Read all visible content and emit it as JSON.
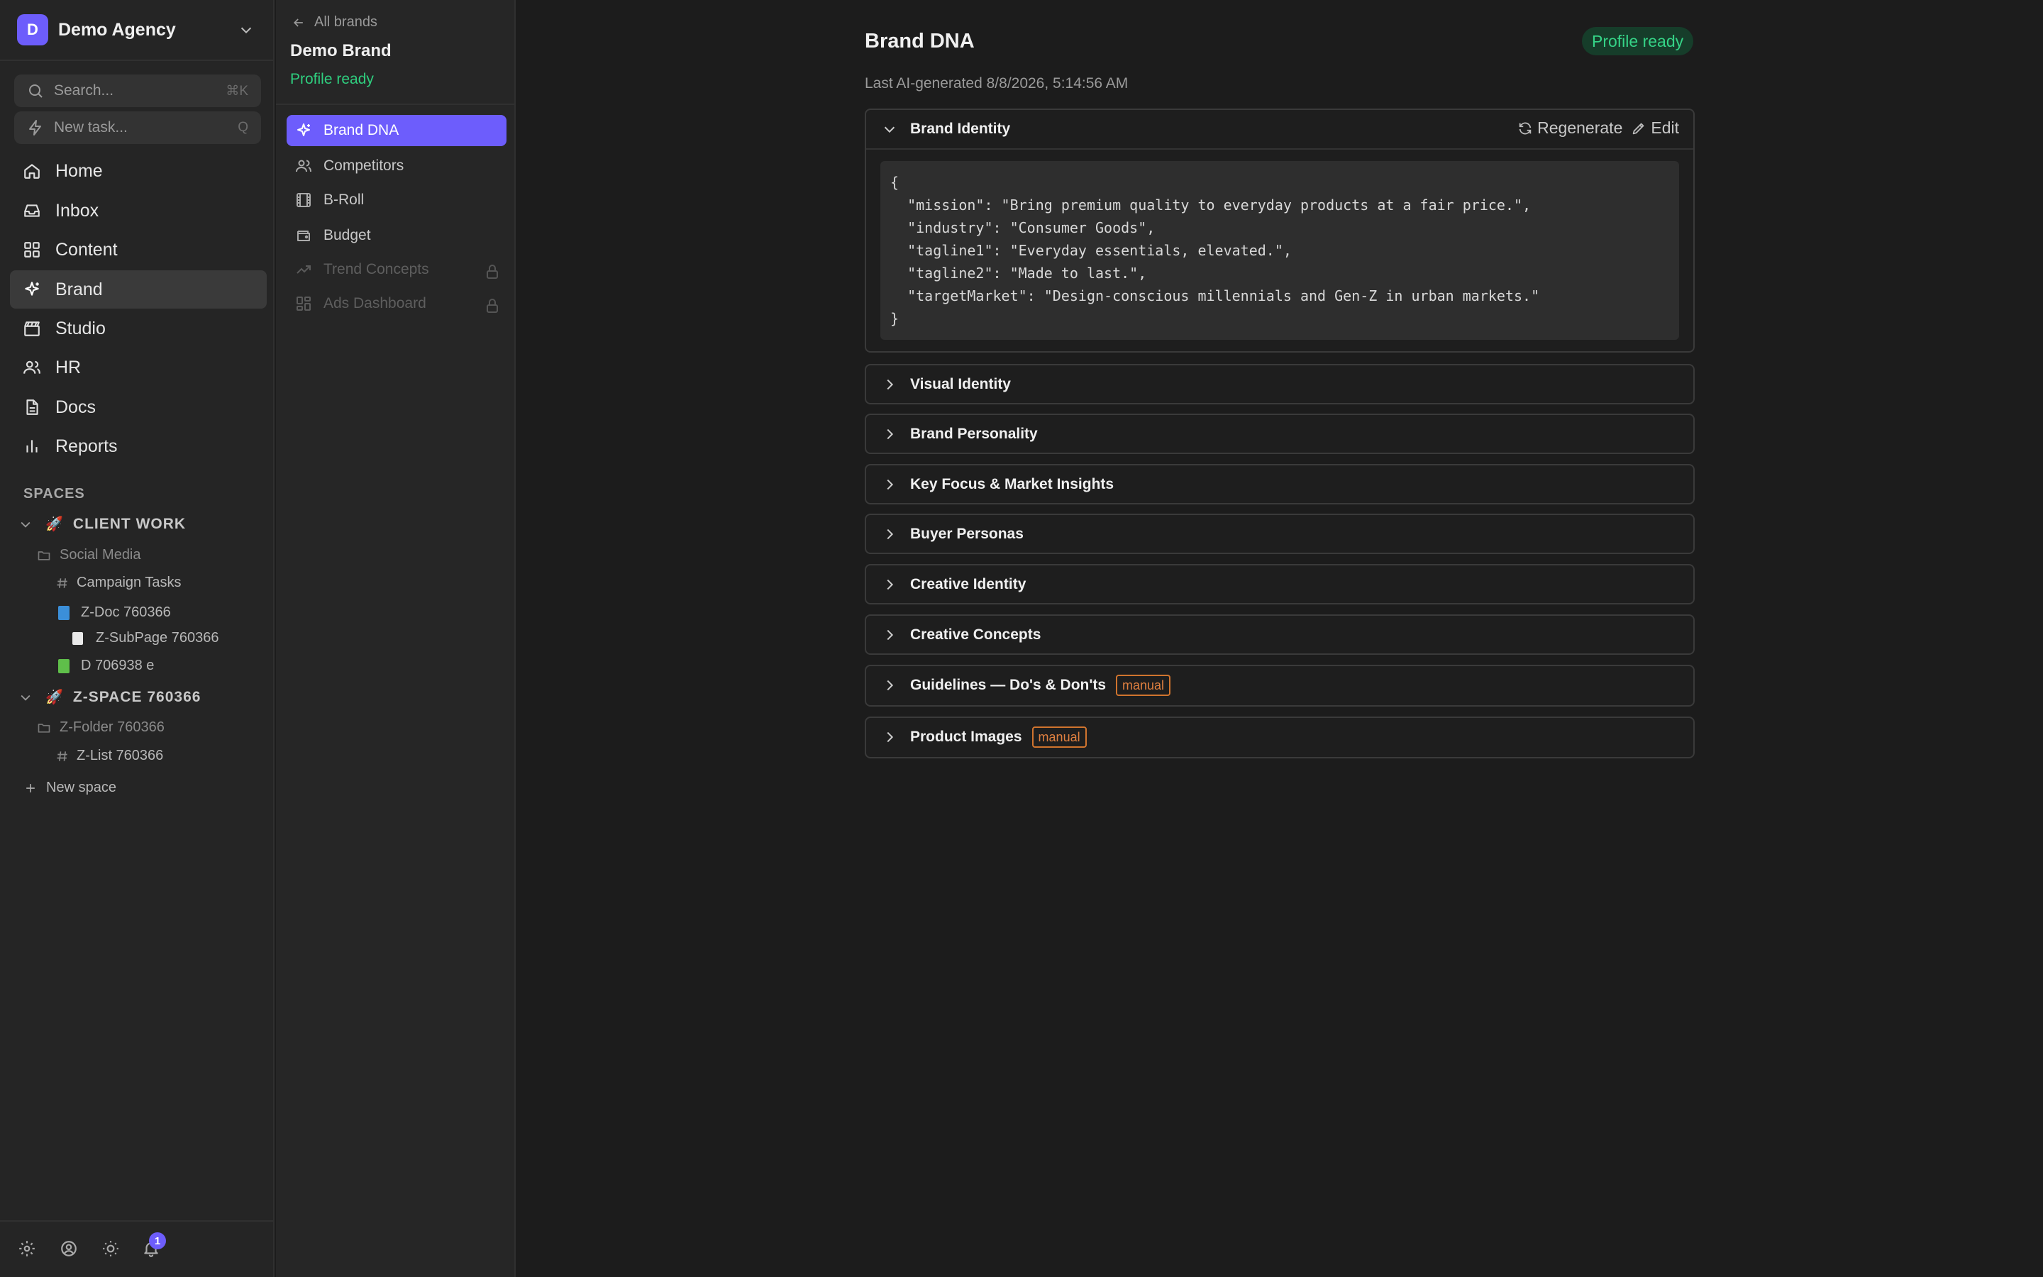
{
  "workspace": {
    "initial": "D",
    "name": "Demo Agency"
  },
  "search": {
    "placeholder": "Search...",
    "shortcut": "⌘K"
  },
  "new_task": {
    "label": "New task...",
    "shortcut": "Q"
  },
  "nav": [
    {
      "label": "Home",
      "icon": "home-icon"
    },
    {
      "label": "Inbox",
      "icon": "inbox-icon"
    },
    {
      "label": "Content",
      "icon": "grid-icon"
    },
    {
      "label": "Brand",
      "icon": "sparkle-icon"
    },
    {
      "label": "Studio",
      "icon": "clapperboard-icon"
    },
    {
      "label": "HR",
      "icon": "users-icon"
    },
    {
      "label": "Docs",
      "icon": "document-icon"
    },
    {
      "label": "Reports",
      "icon": "bar-chart-icon"
    }
  ],
  "active_nav": "Brand",
  "spaces": {
    "header": "SPACES",
    "items": [
      {
        "emoji": "🚀",
        "title": "CLIENT WORK",
        "folder": "Social Media",
        "lists": [
          "Campaign Tasks"
        ],
        "doc": "Z-Doc 760366",
        "subpage": "Z-SubPage 760366",
        "doc2": "D 706938 e"
      },
      {
        "emoji": "🚀",
        "title": "Z-SPACE 760366",
        "folder": "Z-Folder 760366",
        "lists": [
          "Z-List 760366"
        ]
      }
    ],
    "new_space": "New space"
  },
  "footer": {
    "notifications": "1"
  },
  "subnav": {
    "back": "All brands",
    "brand_name": "Demo Brand",
    "status": "Profile ready",
    "items": [
      {
        "label": "Brand DNA",
        "icon": "sparkle-icon",
        "active": true
      },
      {
        "label": "Competitors",
        "icon": "users-icon"
      },
      {
        "label": "B-Roll",
        "icon": "film-icon"
      },
      {
        "label": "Budget",
        "icon": "wallet-icon"
      },
      {
        "label": "Trend Concepts",
        "icon": "trend-icon",
        "locked": true
      },
      {
        "label": "Ads Dashboard",
        "icon": "dashboard-icon",
        "locked": true
      }
    ]
  },
  "main": {
    "title": "Brand DNA",
    "badge": "Profile ready",
    "last_generated": "Last AI-generated 8/8/2026, 5:14:56 AM",
    "regenerate": "Regenerate",
    "edit": "Edit",
    "manual_label": "manual",
    "sections": [
      {
        "title": "Brand Identity",
        "expanded": true
      },
      {
        "title": "Visual Identity"
      },
      {
        "title": "Brand Personality"
      },
      {
        "title": "Key Focus & Market Insights"
      },
      {
        "title": "Buyer Personas"
      },
      {
        "title": "Creative Identity"
      },
      {
        "title": "Creative Concepts"
      },
      {
        "title": "Guidelines — Do's & Don'ts",
        "manual": true
      },
      {
        "title": "Product Images",
        "manual": true
      }
    ],
    "brand_identity_json": "{\n  \"mission\": \"Bring premium quality to everyday products at a fair price.\",\n  \"industry\": \"Consumer Goods\",\n  \"tagline1\": \"Everyday essentials, elevated.\",\n  \"tagline2\": \"Made to last.\",\n  \"targetMarket\": \"Design-conscious millennials and Gen-Z in urban markets.\"\n}"
  },
  "colors": {
    "accent": "#6d5dfc",
    "success": "#35d487",
    "manual": "#e08040"
  }
}
